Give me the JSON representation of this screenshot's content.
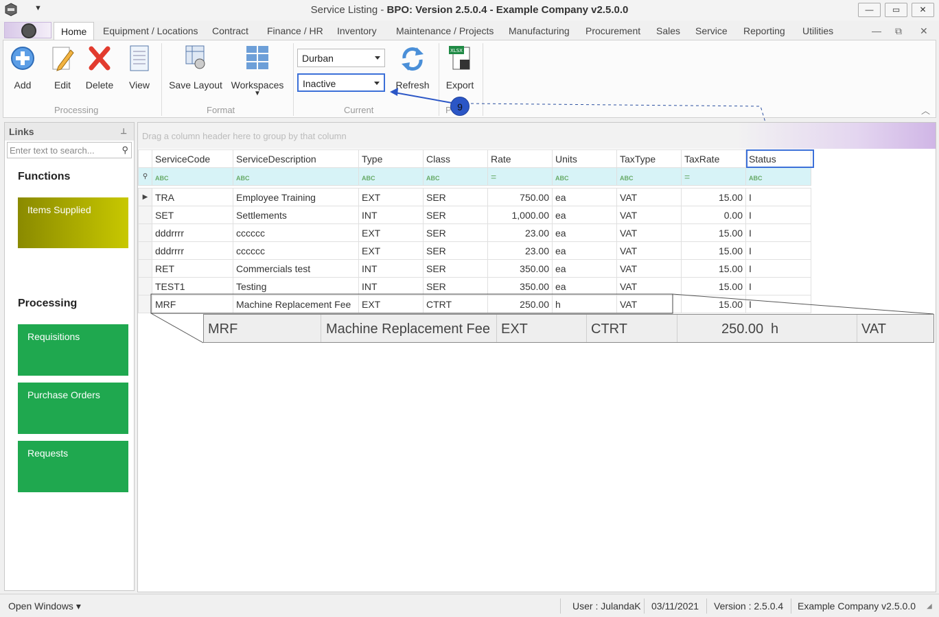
{
  "window": {
    "title_part1": "Service Listing - ",
    "title_part2": "BPO: Version 2.5.0.4 - Example Company v2.5.0.0",
    "buttons": [
      "—",
      "▭",
      "✕"
    ]
  },
  "menu": {
    "tabs": [
      "Home",
      "Equipment / Locations",
      "Contract",
      "Finance / HR",
      "Inventory",
      "Maintenance / Projects",
      "Manufacturing",
      "Procurement",
      "Sales",
      "Service",
      "Reporting",
      "Utilities"
    ],
    "right_controls": [
      "—",
      "⧉",
      "✕"
    ]
  },
  "ribbon": {
    "buttons": {
      "add": "Add",
      "edit": "Edit",
      "delete": "Delete",
      "view": "View",
      "save_layout": "Save Layout",
      "workspaces": "Workspaces",
      "refresh": "Refresh",
      "export": "Export"
    },
    "groups": {
      "processing": "Processing",
      "format": "Format",
      "current": "Current",
      "print_partial": "P"
    },
    "site_select": "Durban",
    "status_select": "Inactive",
    "callout_number": "9"
  },
  "links": {
    "title": "Links",
    "search_placeholder": "Enter text to search...",
    "functions_title": "Functions",
    "functions": [
      "Items Supplied"
    ],
    "processing_title": "Processing",
    "processing": [
      "Requisitions",
      "Purchase Orders",
      "Requests"
    ]
  },
  "grid": {
    "group_hint": "Drag a column header here to group by that column",
    "columns": [
      "ServiceCode",
      "ServiceDescription",
      "Type",
      "Class",
      "Rate",
      "Units",
      "TaxType",
      "TaxRate",
      "Status"
    ],
    "rows": [
      [
        "TRA",
        "Employee Training",
        "EXT",
        "SER",
        "750.00",
        "ea",
        "VAT",
        "15.00",
        "I"
      ],
      [
        "SET",
        "Settlements",
        "INT",
        "SER",
        "1,000.00",
        "ea",
        "VAT",
        "0.00",
        "I"
      ],
      [
        "dddrrrr",
        "cccccc",
        "EXT",
        "SER",
        "23.00",
        "ea",
        "VAT",
        "15.00",
        "I"
      ],
      [
        "dddrrrr",
        "cccccc",
        "EXT",
        "SER",
        "23.00",
        "ea",
        "VAT",
        "15.00",
        "I"
      ],
      [
        "RET",
        "Commercials test",
        "INT",
        "SER",
        "350.00",
        "ea",
        "VAT",
        "15.00",
        "I"
      ],
      [
        "TEST1",
        "Testing",
        "INT",
        "SER",
        "350.00",
        "ea",
        "VAT",
        "15.00",
        "I"
      ],
      [
        "MRF",
        "Machine Replacement Fee",
        "EXT",
        "CTRT",
        "250.00",
        "h",
        "VAT",
        "15.00",
        "I"
      ]
    ],
    "zoom_row": [
      "MRF",
      "Machine Replacement Fee",
      "EXT",
      "CTRT",
      "250.00",
      "h",
      "VAT"
    ]
  },
  "statusbar": {
    "open_windows": "Open Windows ▾",
    "user": "User : JulandaK",
    "date": "03/11/2021",
    "version": "Version : 2.5.0.4",
    "company": "Example Company v2.5.0.0"
  },
  "colors": {
    "accent": "#3b6fd8",
    "callout": "#2b56c6",
    "tile_green": "#1fa84f",
    "tile_olive": "#9aa800"
  }
}
